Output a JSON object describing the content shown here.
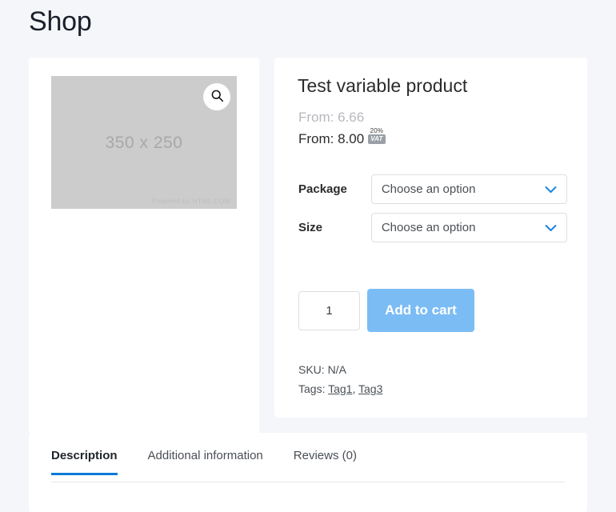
{
  "page": {
    "title": "Shop",
    "background_color": "#f5f6fa",
    "accent_color": "#0b7ad8"
  },
  "gallery": {
    "image_placeholder_dimensions": "350 x 250",
    "image_credit": "Powered by HTML.COM",
    "zoom_icon": "search-icon"
  },
  "product": {
    "title": "Test variable product",
    "price_from_original": "From: 6.66",
    "price_from_current": "From: 8.00",
    "vat_percent": "20%",
    "vat_label": "VAT",
    "attributes": [
      {
        "label": "Package",
        "selected": "Choose an option"
      },
      {
        "label": "Size",
        "selected": "Choose an option"
      }
    ],
    "quantity": "1",
    "add_to_cart_label": "Add to cart",
    "add_to_cart_color": "#7cbcf5",
    "sku_line": "SKU: N/A",
    "tags_label": "Tags:",
    "tags": [
      {
        "name": "Tag1",
        "separator": ", "
      },
      {
        "name": "Tag3",
        "separator": ""
      }
    ]
  },
  "tabs": [
    {
      "label": "Description",
      "active": true
    },
    {
      "label": "Additional information",
      "active": false
    },
    {
      "label": "Reviews (0)",
      "active": false
    }
  ]
}
